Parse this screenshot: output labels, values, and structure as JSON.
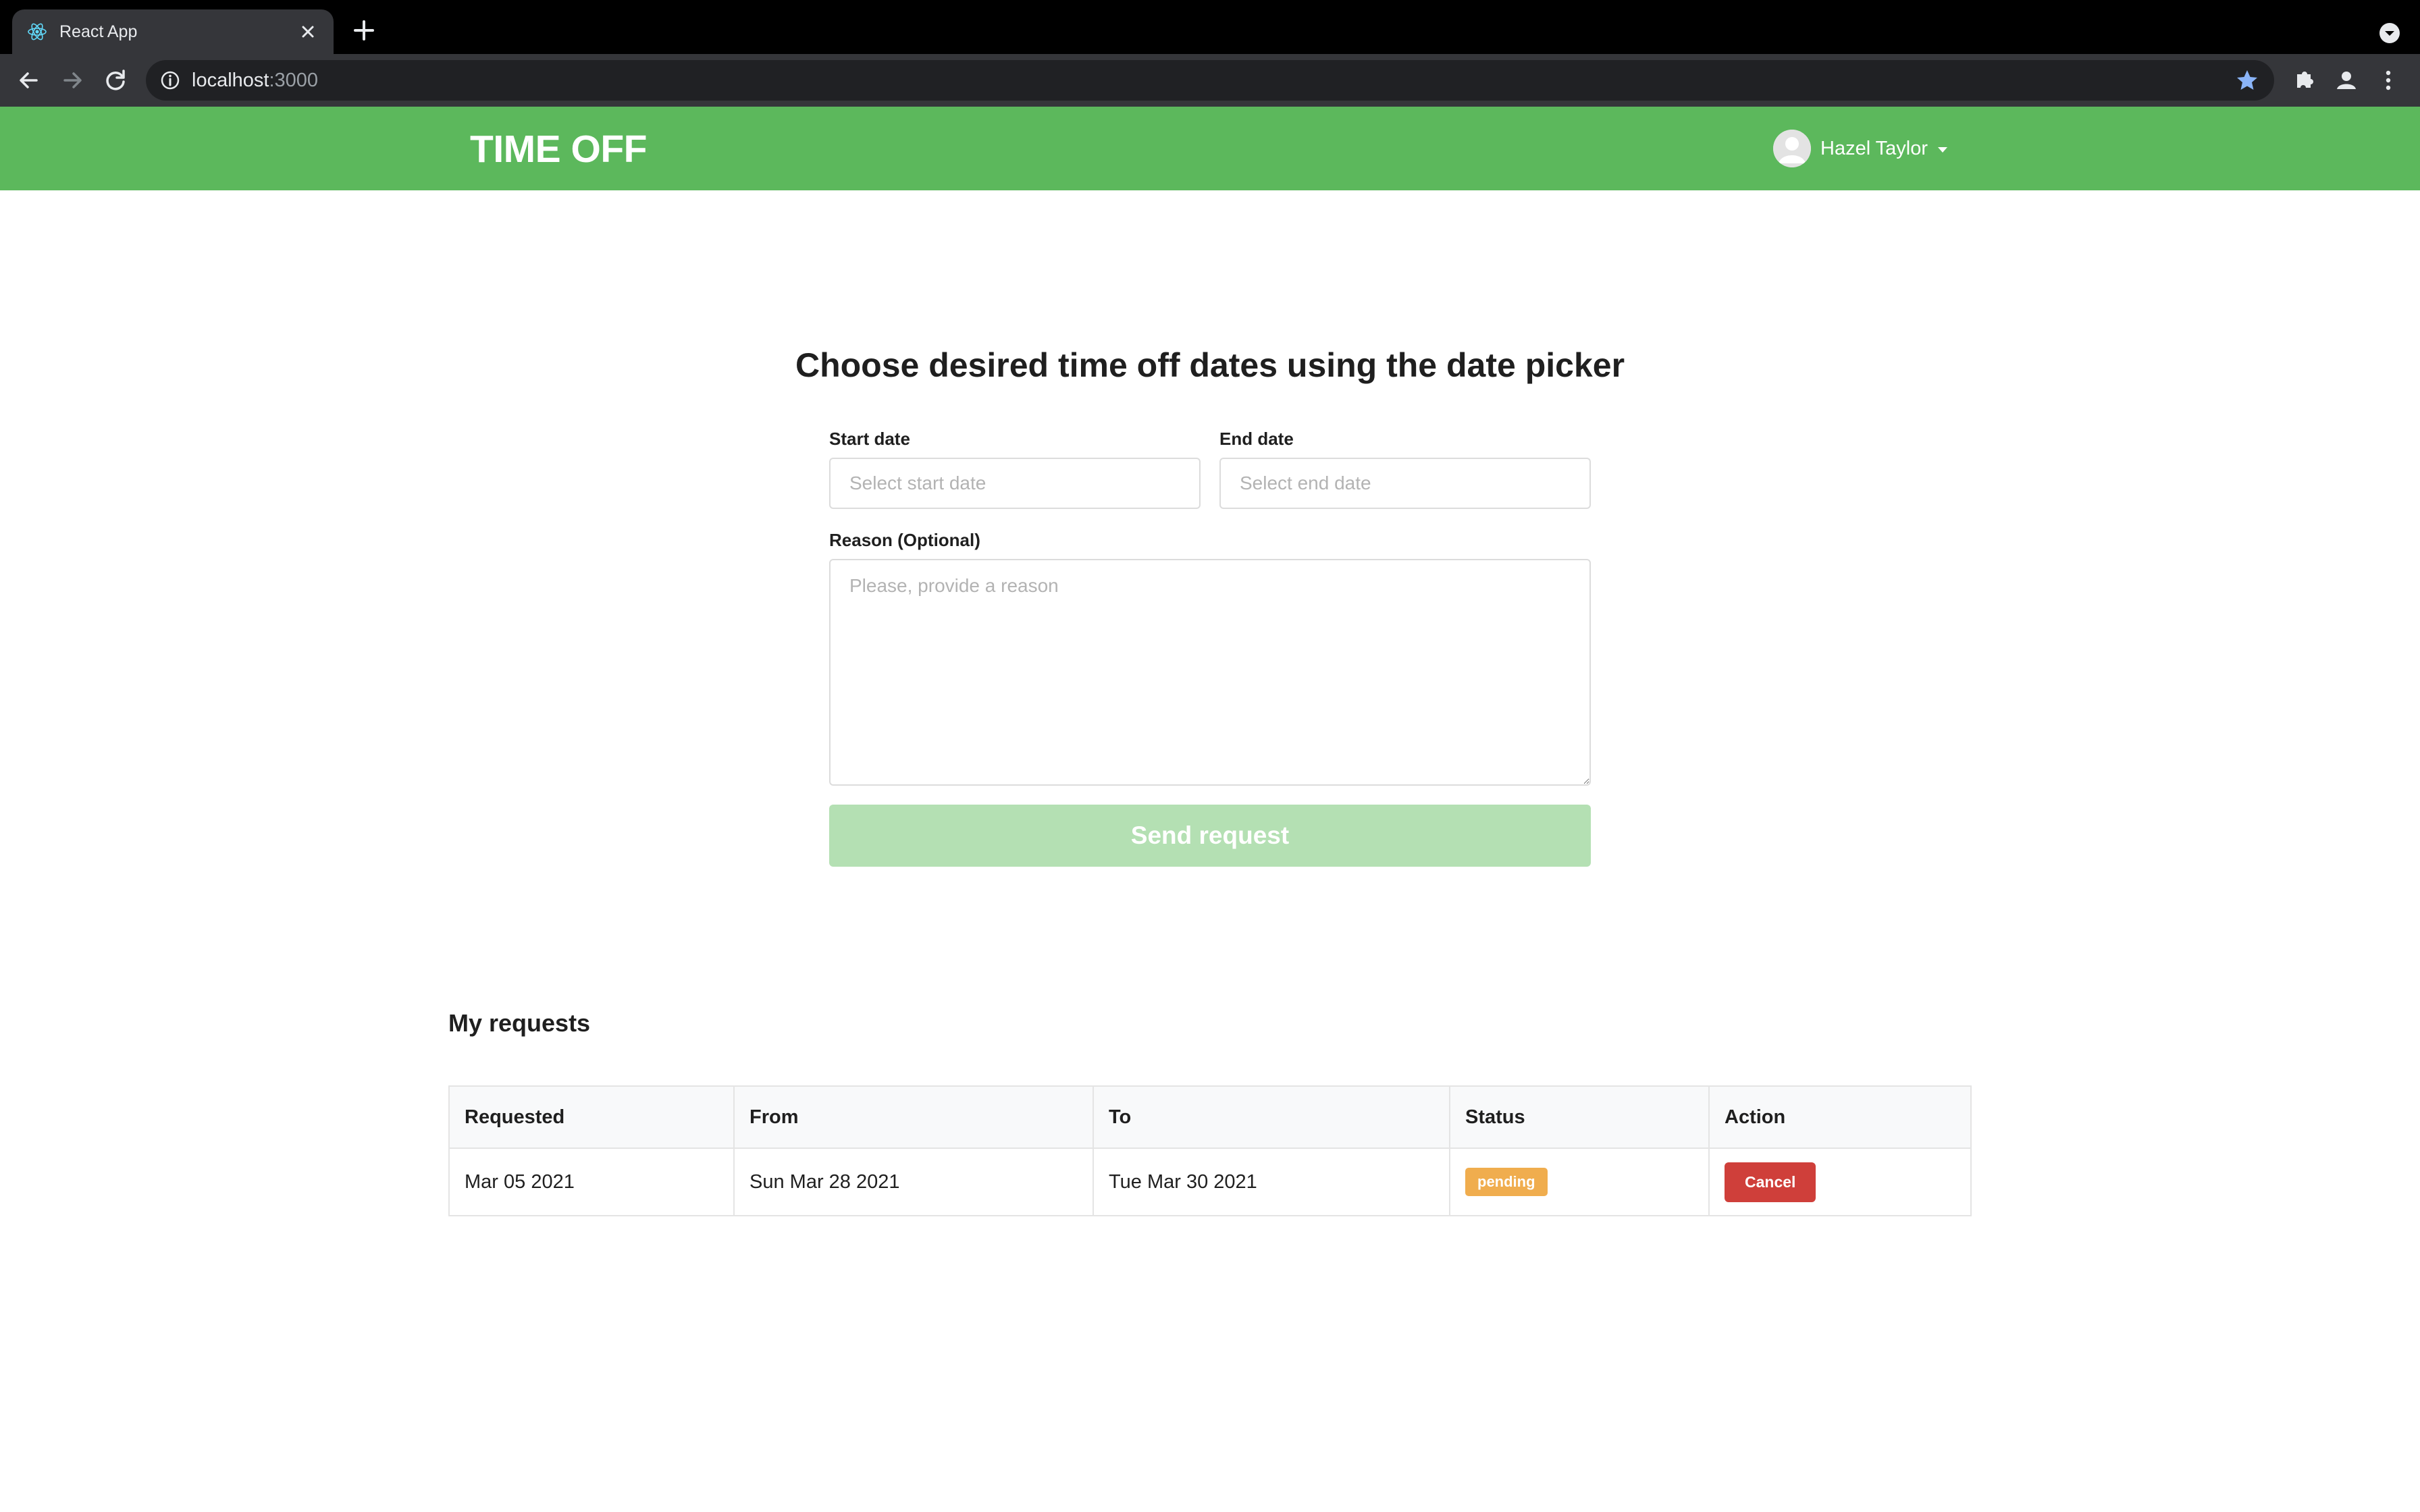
{
  "browser": {
    "tab_title": "React App",
    "url_host": "localhost",
    "url_port": ":3000"
  },
  "header": {
    "logo": "TIME OFF",
    "user_name": "Hazel Taylor",
    "bg_color": "#5cb85c"
  },
  "form": {
    "title": "Choose desired time off dates using the date picker",
    "start_label": "Start date",
    "start_placeholder": "Select start date",
    "start_value": "",
    "end_label": "End date",
    "end_placeholder": "Select end date",
    "end_value": "",
    "reason_label": "Reason (Optional)",
    "reason_placeholder": "Please, provide a reason",
    "reason_value": "",
    "submit_label": "Send request",
    "submit_color": "#b4e0b3"
  },
  "requests": {
    "title": "My requests",
    "columns": [
      "Requested",
      "From",
      "To",
      "Status",
      "Action"
    ],
    "rows": [
      {
        "requested": "Mar 05 2021",
        "from": "Sun Mar 28 2021",
        "to": "Tue Mar 30 2021",
        "status": "pending",
        "action": "Cancel"
      }
    ],
    "status_color": "#f0ad4e",
    "cancel_color": "#cf3f3a"
  }
}
